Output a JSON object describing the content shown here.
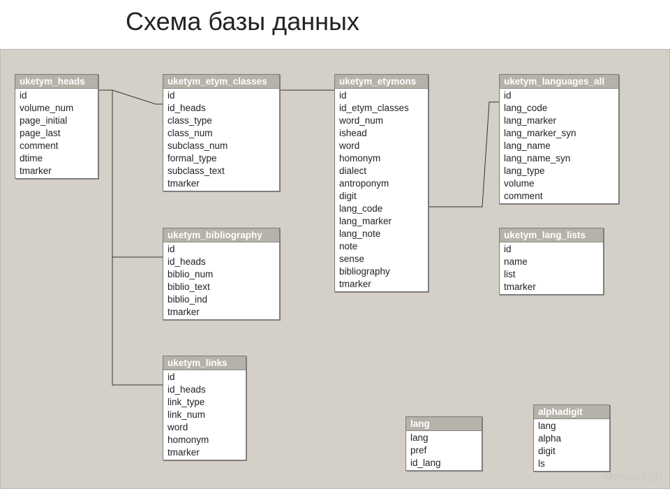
{
  "title": "Схема базы данных",
  "watermark": "MYSHARED",
  "tables": {
    "heads": {
      "name": "uketym_heads",
      "fields": [
        "id",
        "volume_num",
        "page_initial",
        "page_last",
        "comment",
        "dtime",
        "tmarker"
      ]
    },
    "etym_classes": {
      "name": "uketym_etym_classes",
      "fields": [
        "id",
        "id_heads",
        "class_type",
        "class_num",
        "subclass_num",
        "formal_type",
        "subclass_text",
        "tmarker"
      ]
    },
    "etymons": {
      "name": "uketym_etymons",
      "fields": [
        "id",
        "id_etym_classes",
        "word_num",
        "ishead",
        "word",
        "homonym",
        "dialect",
        "antroponym",
        "digit",
        "lang_code",
        "lang_marker",
        "lang_note",
        "note",
        "sense",
        "bibliography",
        "tmarker"
      ]
    },
    "languages_all": {
      "name": "uketym_languages_all",
      "fields": [
        "id",
        "lang_code",
        "lang_marker",
        "lang_marker_syn",
        "lang_name",
        "lang_name_syn",
        "lang_type",
        "volume",
        "comment"
      ]
    },
    "bibliography": {
      "name": "uketym_bibliography",
      "fields": [
        "id",
        "id_heads",
        "biblio_num",
        "biblio_text",
        "biblio_ind",
        "tmarker"
      ]
    },
    "lang_lists": {
      "name": "uketym_lang_lists",
      "fields": [
        "id",
        "name",
        "list",
        "tmarker"
      ]
    },
    "links": {
      "name": "uketym_links",
      "fields": [
        "id",
        "id_heads",
        "link_type",
        "link_num",
        "word",
        "homonym",
        "tmarker"
      ]
    },
    "lang": {
      "name": "lang",
      "fields": [
        "lang",
        "pref",
        "id_lang"
      ]
    },
    "alphadigit": {
      "name": "alphadigit",
      "fields": [
        "lang",
        "alpha",
        "digit",
        "ls"
      ]
    }
  }
}
